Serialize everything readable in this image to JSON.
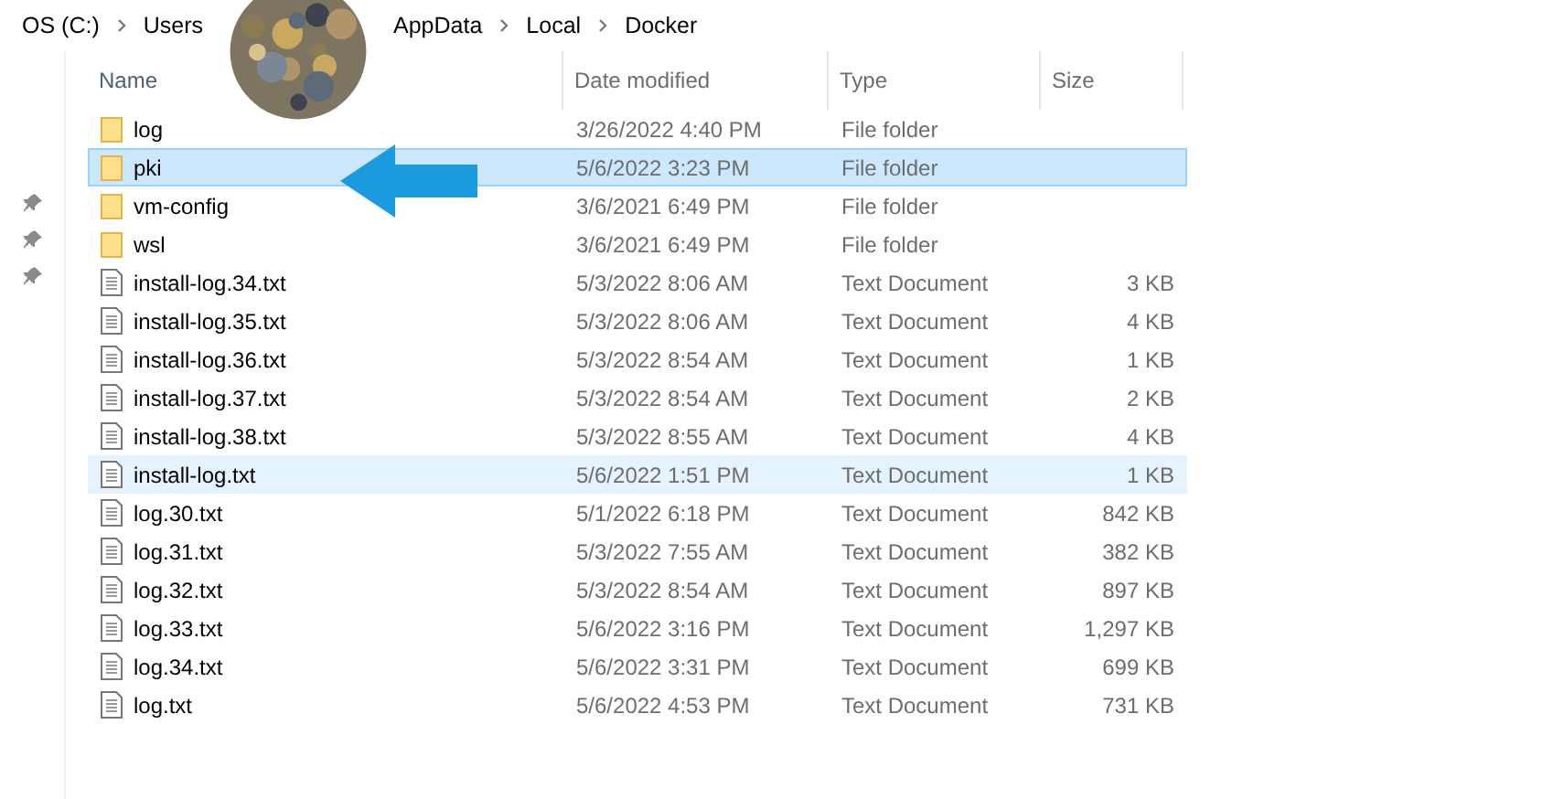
{
  "breadcrumb": [
    {
      "kind": "folder",
      "label": "OS (C:)"
    },
    {
      "kind": "folder",
      "label": "Users"
    },
    {
      "kind": "redacted"
    },
    {
      "kind": "folder",
      "label": "AppData"
    },
    {
      "kind": "folder",
      "label": "Local"
    },
    {
      "kind": "folder",
      "label": "Docker"
    }
  ],
  "columns": [
    "Name",
    "Date modified",
    "Type",
    "Size"
  ],
  "rows": [
    {
      "kind": "folder",
      "name": "log",
      "date": "3/26/2022 4:40 PM",
      "type": "File folder",
      "selected": false,
      "hovered": false
    },
    {
      "kind": "folder",
      "name": "pki",
      "date": "5/6/2022 3:23 PM",
      "type": "File folder",
      "selected": true,
      "hovered": false
    },
    {
      "kind": "folder",
      "name": "vm-config",
      "date": "3/6/2021 6:49 PM",
      "type": "File folder",
      "selected": false,
      "hovered": false
    },
    {
      "kind": "folder",
      "name": "wsl",
      "date": "3/6/2021 6:49 PM",
      "type": "File folder",
      "selected": false,
      "hovered": false
    },
    {
      "kind": "file",
      "name": "install-log.34.txt",
      "date": "5/3/2022 8:06 AM",
      "type": "Text Document",
      "size": "3 KB",
      "selected": false,
      "hovered": false
    },
    {
      "kind": "file",
      "name": "install-log.35.txt",
      "date": "5/3/2022 8:06 AM",
      "type": "Text Document",
      "size": "4 KB",
      "selected": false,
      "hovered": false
    },
    {
      "kind": "file",
      "name": "install-log.36.txt",
      "date": "5/3/2022 8:54 AM",
      "type": "Text Document",
      "size": "1 KB",
      "selected": false,
      "hovered": false
    },
    {
      "kind": "file",
      "name": "install-log.37.txt",
      "date": "5/3/2022 8:54 AM",
      "type": "Text Document",
      "size": "2 KB",
      "selected": false,
      "hovered": false
    },
    {
      "kind": "file",
      "name": "install-log.38.txt",
      "date": "5/3/2022 8:55 AM",
      "type": "Text Document",
      "size": "4 KB",
      "selected": false,
      "hovered": false
    },
    {
      "kind": "file",
      "name": "install-log.txt",
      "date": "5/6/2022 1:51 PM",
      "type": "Text Document",
      "size": "1 KB",
      "selected": false,
      "hovered": true
    },
    {
      "kind": "file",
      "name": "log.30.txt",
      "date": "5/1/2022 6:18 PM",
      "type": "Text Document",
      "size": "842 KB",
      "selected": false,
      "hovered": false
    },
    {
      "kind": "file",
      "name": "log.31.txt",
      "date": "5/3/2022 7:55 AM",
      "type": "Text Document",
      "size": "382 KB",
      "selected": false,
      "hovered": false
    },
    {
      "kind": "file",
      "name": "log.32.txt",
      "date": "5/3/2022 8:54 AM",
      "type": "Text Document",
      "size": "897 KB",
      "selected": false,
      "hovered": false
    },
    {
      "kind": "file",
      "name": "log.33.txt",
      "date": "5/6/2022 3:16 PM",
      "type": "Text Document",
      "size": "1,297 KB",
      "selected": false,
      "hovered": false
    },
    {
      "kind": "file",
      "name": "log.34.txt",
      "date": "5/6/2022 3:31 PM",
      "type": "Text Document",
      "size": "699 KB",
      "selected": false,
      "hovered": false
    },
    {
      "kind": "file",
      "name": "log.txt",
      "date": "5/6/2022 4:53 PM",
      "type": "Text Document",
      "size": "731 KB",
      "selected": false,
      "hovered": false
    }
  ]
}
